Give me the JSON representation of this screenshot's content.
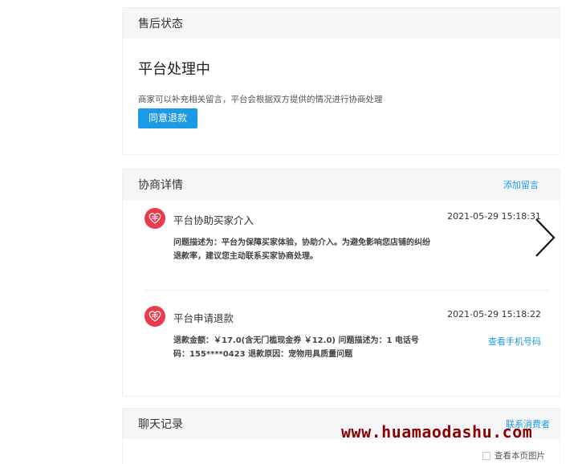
{
  "status_card": {
    "header": "售后状态",
    "title": "平台处理中",
    "description": "商家可以补充相关留言，平台会根据双方提供的情况进行协商处理",
    "agree_button": "同意退款"
  },
  "detail_card": {
    "header": "协商详情",
    "add_message_link": "添加留言",
    "events": [
      {
        "title": "平台协助买家介入",
        "time": "2021-05-29 15:18:31",
        "description": "问题描述为：平台为保障买家体验，协助介入。为避免影响您店铺的纠纷退款率，建议您主动联系买家协商处理。",
        "icon": "platform-logo-icon"
      },
      {
        "title": "平台申请退款",
        "time": "2021-05-29 15:18:22",
        "description": "退款金额：￥17.0(含无门槛现金券 ￥12.0) 问题描述为：1 电话号码：155****0423 退款原因：宠物用具质量问题",
        "link": "查看手机号码",
        "icon": "platform-logo-icon"
      }
    ]
  },
  "chat_card": {
    "header": "聊天记录",
    "contact_link": "联系消费者",
    "view_images_label": "查看本页图片"
  },
  "nav": {
    "next_icon": "chevron-right-icon"
  },
  "watermark": "www.huamaodashu.com",
  "colors": {
    "accent": "#1c9ae6",
    "avatar": "#e93a4e",
    "header_bg": "#f4f6f8",
    "watermark": "#8b0000"
  }
}
